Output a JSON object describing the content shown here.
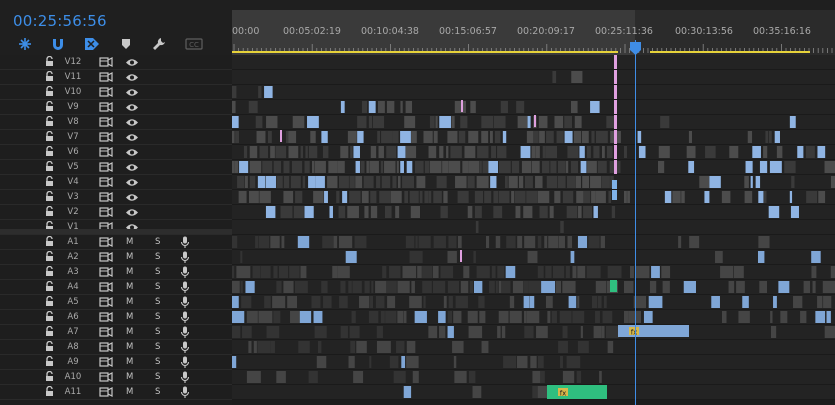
{
  "timecode": "00:25:56:56",
  "tools": [
    {
      "name": "insert-overwrite-icon",
      "symbol": "snap-cross"
    },
    {
      "name": "snap-magnet-icon",
      "symbol": "magnet"
    },
    {
      "name": "linked-selection-icon",
      "symbol": "link"
    },
    {
      "name": "add-marker-icon",
      "symbol": "marker"
    },
    {
      "name": "settings-wrench-icon",
      "symbol": "wrench"
    },
    {
      "name": "captions-icon",
      "symbol": "cc"
    }
  ],
  "ruler": {
    "labels": [
      "00:00",
      "00:05:02:19",
      "00:10:04:38",
      "00:15:06:57",
      "00:20:09:17",
      "00:25:11:36",
      "00:30:13:56",
      "00:35:16:16"
    ]
  },
  "playhead": {
    "timecode_position": "00:25:56:56",
    "label_fragment": "1"
  },
  "video_tracks": [
    {
      "name": "V12"
    },
    {
      "name": "V11"
    },
    {
      "name": "V10"
    },
    {
      "name": "V9"
    },
    {
      "name": "V8"
    },
    {
      "name": "V7"
    },
    {
      "name": "V6"
    },
    {
      "name": "V5"
    },
    {
      "name": "V4"
    },
    {
      "name": "V3"
    },
    {
      "name": "V2"
    },
    {
      "name": "V1"
    }
  ],
  "audio_tracks": [
    {
      "name": "A1",
      "mute": "M",
      "solo": "S"
    },
    {
      "name": "A2",
      "mute": "M",
      "solo": "S"
    },
    {
      "name": "A3",
      "mute": "M",
      "solo": "S"
    },
    {
      "name": "A4",
      "mute": "M",
      "solo": "S"
    },
    {
      "name": "A5",
      "mute": "M",
      "solo": "S"
    },
    {
      "name": "A6",
      "mute": "M",
      "solo": "S"
    },
    {
      "name": "A7",
      "mute": "M",
      "solo": "S"
    },
    {
      "name": "A8",
      "mute": "M",
      "solo": "S"
    },
    {
      "name": "A9",
      "mute": "M",
      "solo": "S"
    },
    {
      "name": "A10",
      "mute": "M",
      "solo": "S"
    },
    {
      "name": "A11",
      "mute": "M",
      "solo": "S"
    }
  ],
  "clips": {
    "fx_label": "fx"
  },
  "colors": {
    "accent": "#3d8ee8",
    "clip_dark": "#3a3a3a",
    "clip_light": "#55606c",
    "video_blue": "#8fb4e3",
    "pink": "#e0a0e0",
    "green": "#2fbf7f",
    "audio_blue": "#7fa6d6",
    "work_area": "#e6d23a"
  }
}
